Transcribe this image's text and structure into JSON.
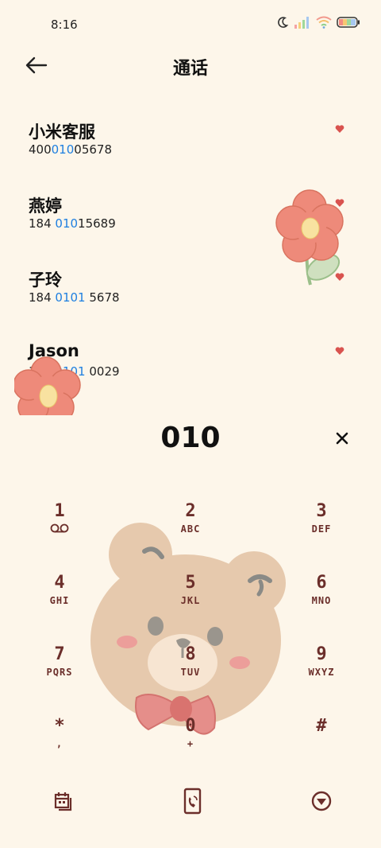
{
  "status": {
    "time": "8:16",
    "icons": [
      "moon-icon",
      "signal-icon",
      "wifi-icon",
      "battery-icon"
    ]
  },
  "header": {
    "title": "通话"
  },
  "contacts": [
    {
      "name": "小米客服",
      "num_pre": "400",
      "num_hl": "010",
      "num_post": "05678"
    },
    {
      "name": "燕婷",
      "num_pre": "184 ",
      "num_hl": "010",
      "num_post": "15689"
    },
    {
      "name": "子玲",
      "num_pre": "184 ",
      "num_hl": "0101",
      "num_post": " 5678"
    },
    {
      "name": "Jason",
      "num_pre": "184 ",
      "num_hl": "0101",
      "num_post": " 0029"
    }
  ],
  "dialer": {
    "number": "010"
  },
  "keypad": [
    {
      "digit": "1",
      "letters": ""
    },
    {
      "digit": "2",
      "letters": "ABC"
    },
    {
      "digit": "3",
      "letters": "DEF"
    },
    {
      "digit": "4",
      "letters": "GHI"
    },
    {
      "digit": "5",
      "letters": "JKL"
    },
    {
      "digit": "6",
      "letters": "MNO"
    },
    {
      "digit": "7",
      "letters": "PQRS"
    },
    {
      "digit": "8",
      "letters": "TUV"
    },
    {
      "digit": "9",
      "letters": "WXYZ"
    },
    {
      "digit": "*",
      "letters": ","
    },
    {
      "digit": "0",
      "letters": "+"
    },
    {
      "digit": "#",
      "letters": ""
    }
  ],
  "colors": {
    "background": "#fdf6ea",
    "highlight": "#1e7fe0",
    "keypad_text": "#6b2e2a",
    "heart": "#d9534f"
  }
}
